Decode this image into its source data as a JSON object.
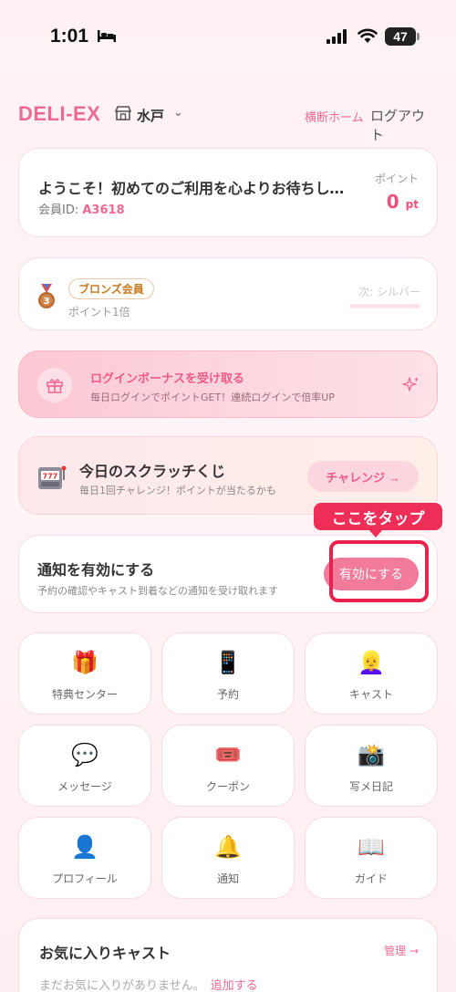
{
  "status_bar": {
    "time": "1:01",
    "battery": "47"
  },
  "header": {
    "logo": "DELI-EX",
    "location": "水戸",
    "cross_home": "横断ホーム",
    "logout": "ログアウト"
  },
  "welcome": {
    "message": "ようこそ！初めてのご利用を心よりお待ちしております",
    "member_id_label": "会員ID:",
    "member_id": "A3618",
    "points_label": "ポイント",
    "points_value": "0",
    "points_unit": "pt"
  },
  "rank": {
    "badge": "ブロンズ会員",
    "multiplier": "ポイント1倍",
    "next": "次: シルバー",
    "progress_to_next": 0
  },
  "login_bonus": {
    "title": "ログインボーナスを受け取る",
    "subtitle": "毎日ログインでポイントGET！連続ログインで倍率UP"
  },
  "scratch": {
    "title": "今日のスクラッチくじ",
    "subtitle": "毎日1回チャレンジ！ポイントが当たるかも",
    "button": "チャレンジ →"
  },
  "notification": {
    "title": "通知を有効にする",
    "subtitle": "予約の確認やキャスト到着などの通知を受け取れます",
    "button": "有効にする",
    "callout": "ここをタップ"
  },
  "menu": [
    {
      "icon": "gift-icon",
      "label": "特典センター"
    },
    {
      "icon": "phone-icon",
      "label": "予約"
    },
    {
      "icon": "woman-icon",
      "label": "キャスト"
    },
    {
      "icon": "speech-bubble-icon",
      "label": "メッセージ"
    },
    {
      "icon": "ticket-icon",
      "label": "クーポン"
    },
    {
      "icon": "camera-icon",
      "label": "写メ日記"
    },
    {
      "icon": "person-icon",
      "label": "プロフィール"
    },
    {
      "icon": "bell-icon",
      "label": "通知"
    },
    {
      "icon": "book-icon",
      "label": "ガイド"
    }
  ],
  "favorites": {
    "title": "お気に入りキャスト",
    "manage": "管理 →",
    "empty": "まだお気に入りがありません。",
    "add": "追加する"
  },
  "colors": {
    "accent": "#ef6a92",
    "callout": "#ee2e56"
  }
}
